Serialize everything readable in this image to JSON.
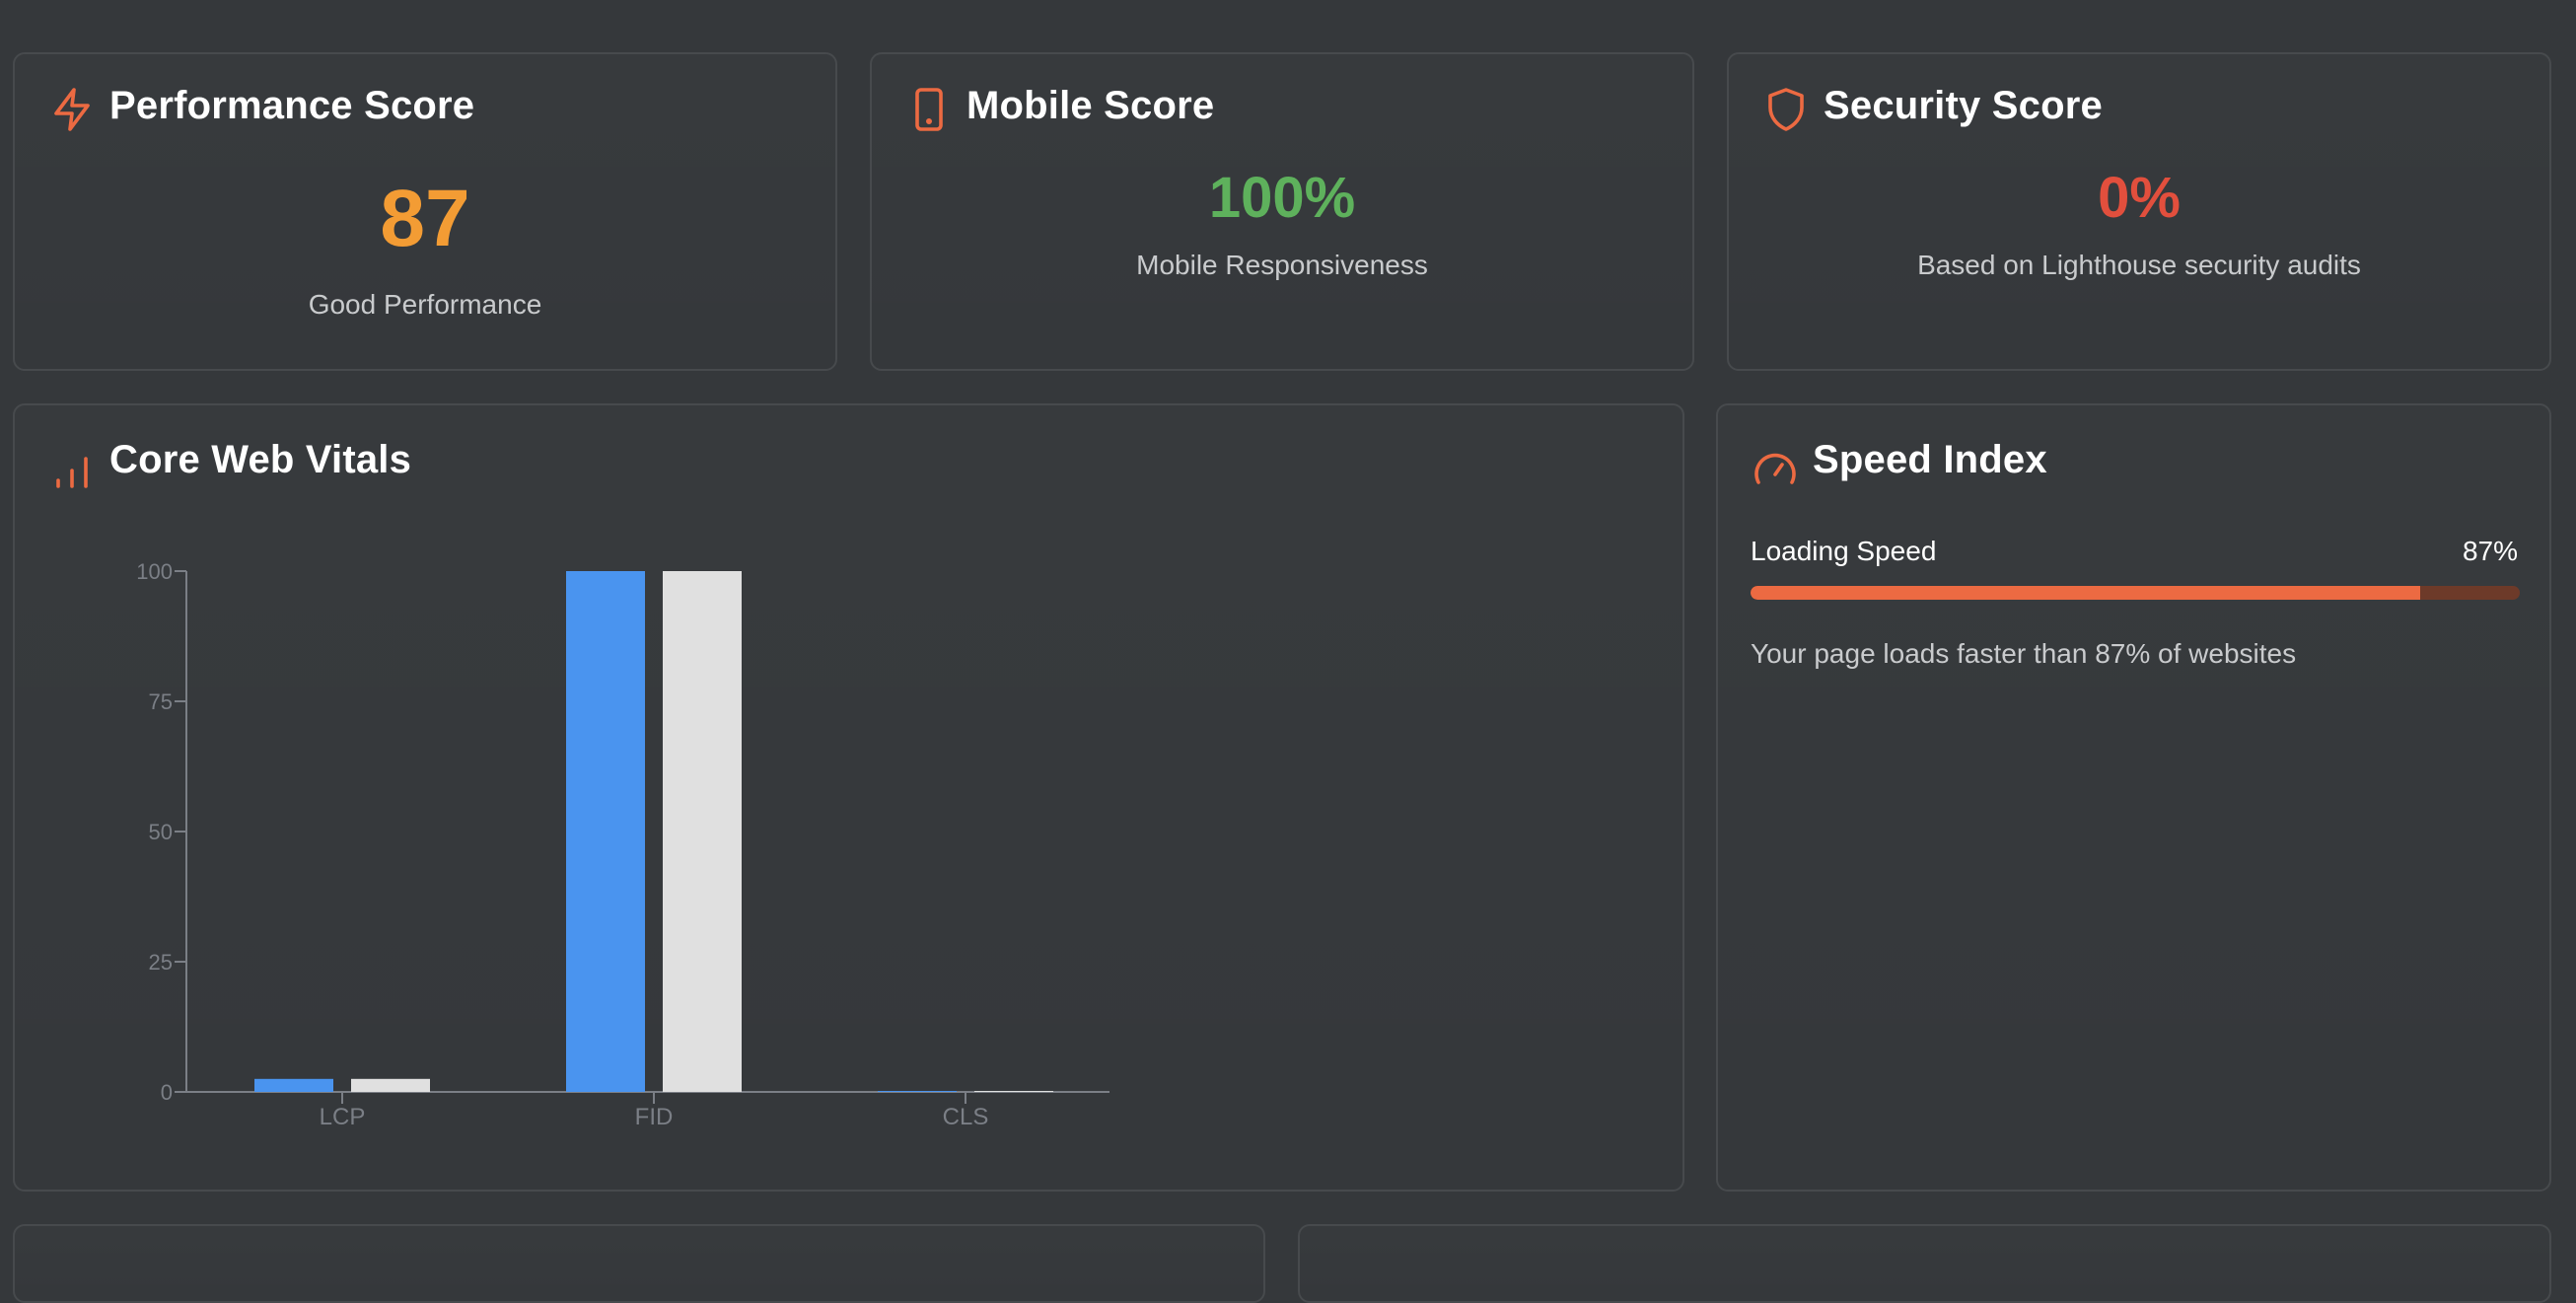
{
  "colors": {
    "accent": "#ec6a42",
    "performance": "#f39c34",
    "mobile": "#5eb15c",
    "security": "#e24f3d",
    "bar_series_1": "#4a94ef",
    "bar_series_2": "#e0e0e0",
    "axis": "#7b7f86"
  },
  "performance": {
    "icon": "lightning-icon",
    "title": "Performance Score",
    "value": "87",
    "label": "Good Performance"
  },
  "mobile": {
    "icon": "phone-icon",
    "title": "Mobile Score",
    "value": "100%",
    "label": "Mobile Responsiveness"
  },
  "security": {
    "icon": "shield-icon",
    "title": "Security Score",
    "value": "0%",
    "label": "Based on Lighthouse security audits"
  },
  "vitals": {
    "icon": "bar-chart-icon",
    "title": "Core Web Vitals"
  },
  "speed": {
    "icon": "speedometer-icon",
    "title": "Speed Index",
    "label": "Loading Speed",
    "percent_text": "87%",
    "percent": 87,
    "note": "Your page loads faster than 87% of websites"
  },
  "chart_data": {
    "type": "bar",
    "categories": [
      "LCP",
      "FID",
      "CLS"
    ],
    "series": [
      {
        "values": [
          2.5,
          100,
          0.1
        ]
      },
      {
        "values": [
          2.5,
          100,
          0.1
        ]
      }
    ],
    "ylim": [
      0,
      100
    ],
    "yticks": [
      "0",
      "25",
      "50",
      "75",
      "100"
    ],
    "ytick_values": [
      0,
      25,
      50,
      75,
      100
    ],
    "grid": false,
    "title": "",
    "xlabel": "",
    "ylabel": ""
  }
}
